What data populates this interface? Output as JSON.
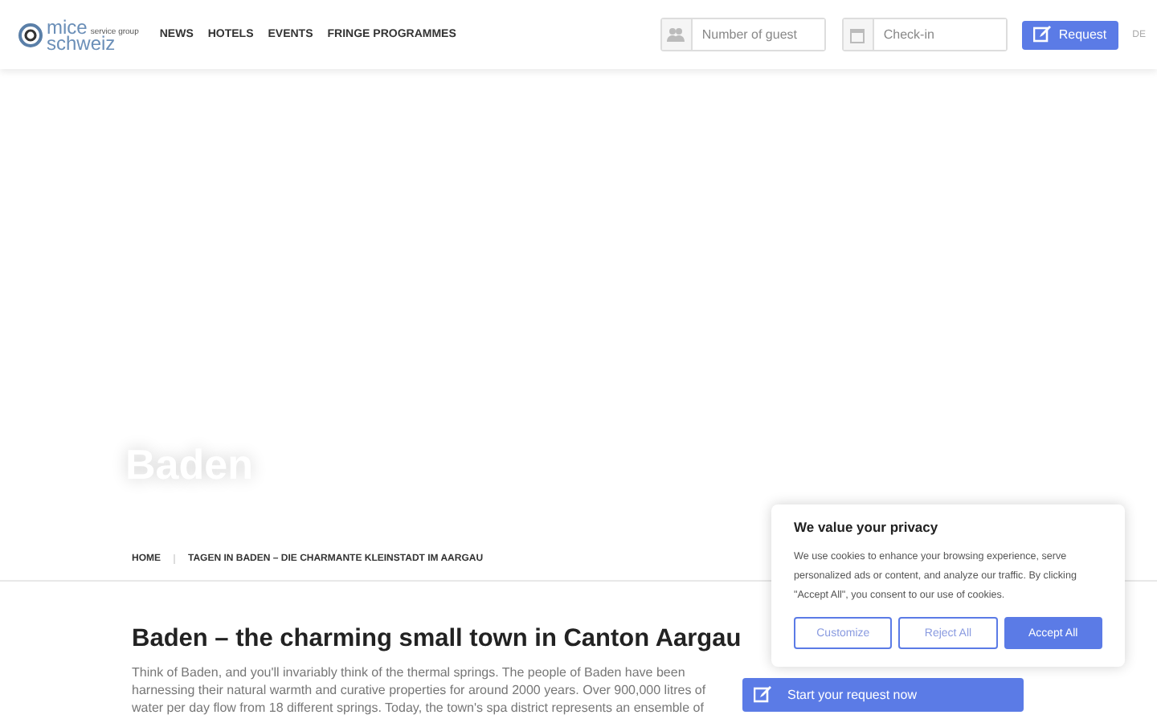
{
  "header": {
    "logo": {
      "word1": "mice",
      "tagline": "service group",
      "word2": "schweiz"
    },
    "nav": [
      "NEWS",
      "HOTELS",
      "EVENTS",
      "FRINGE PROGRAMMES"
    ],
    "guests": {
      "placeholder": "Number of guest"
    },
    "checkin": {
      "placeholder": "Check-in"
    },
    "request_button": "Request",
    "language": "DE"
  },
  "hero": {
    "title": "Baden"
  },
  "breadcrumb": [
    "HOME",
    "TAGEN IN BADEN – DIE CHARMANTE KLEINSTADT IM AARGAU"
  ],
  "article": {
    "heading": "Baden – the charming small town in Canton Aargau",
    "lines": [
      "Think of Baden, and you'll invariably think of the thermal springs. The people of Baden have been",
      "harnessing their natural warmth and curative properties for around 2000 years. Over 900,000 litres of",
      "water per day flow from 18 different springs. Today, the town's spa district represents an ensemble of"
    ]
  },
  "sidebar": {
    "start_button": "Start your request now"
  },
  "cookie": {
    "title": "We value your privacy",
    "text": "We use cookies to enhance your browsing experience, serve personalized ads or content, and analyze our traffic. By clicking \"Accept All\", you consent to our use of cookies.",
    "buttons": [
      {
        "label": "Customize",
        "kind": "outline"
      },
      {
        "label": "Reject All",
        "kind": "outline"
      },
      {
        "label": "Accept All",
        "kind": "primary"
      }
    ]
  }
}
